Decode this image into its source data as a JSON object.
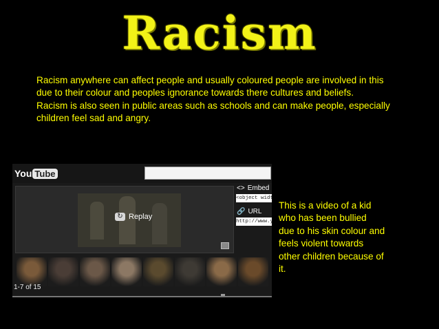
{
  "title": "Racism",
  "intro": {
    "lines": [
      "Racism anywhere can affect people and usually coloured people are involved in this",
      "due to their colour and peoples ignorance towards there cultures and beliefs.",
      "Racism is also seen in public areas such as schools and can make people, especially",
      "children feel sad and angry."
    ]
  },
  "youtube": {
    "logo_you": "You",
    "logo_tube": "Tube",
    "replay_label": "Replay",
    "embed_label": "Embed",
    "embed_value": "<object width=\"",
    "url_label": "URL",
    "url_value": "http://www.yo",
    "count": "1-7 of 15",
    "thumbnail_colors": [
      "#7a5a3a",
      "#4a3d36",
      "#6b5848",
      "#8c7864",
      "#5a4a2e",
      "#3e3a34",
      "#8a6a48",
      "#6a4a2a"
    ]
  },
  "description": {
    "lines": [
      "This is a video of a kid",
      "who has been bullied",
      "due to his skin colour and",
      "feels violent towards",
      "other children because of",
      "it."
    ]
  },
  "colors": {
    "text": "#ffff00",
    "title": "#f2f218",
    "background": "#000000"
  }
}
